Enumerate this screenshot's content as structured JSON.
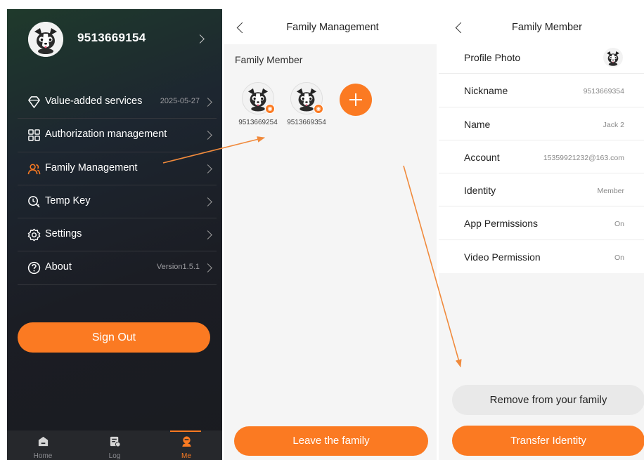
{
  "colors": {
    "accent": "#fb7a22",
    "drawer_bg": "#1b1d24",
    "panel_bg": "#f5f5f5"
  },
  "me_panel": {
    "username": "9513669154",
    "menu": [
      {
        "label": "Value-added services",
        "value": "2025-05-27",
        "icon": "diamond-icon"
      },
      {
        "label": "Authorization management",
        "value": "",
        "icon": "grid-icon"
      },
      {
        "label": "Family Management",
        "value": "",
        "icon": "family-icon"
      },
      {
        "label": "Temp Key",
        "value": "",
        "icon": "temp-key-icon"
      },
      {
        "label": "Settings",
        "value": "",
        "icon": "gear-icon"
      },
      {
        "label": "About",
        "value": "Version1.5.1",
        "icon": "question-icon"
      }
    ],
    "sign_out": "Sign Out",
    "tabs": [
      {
        "label": "Home",
        "icon": "home-icon",
        "active": false
      },
      {
        "label": "Log",
        "icon": "log-icon",
        "active": false
      },
      {
        "label": "Me",
        "icon": "me-icon",
        "active": true
      }
    ]
  },
  "family_management": {
    "title": "Family Management",
    "section_title": "Family Member",
    "members": [
      {
        "name": "9513669254"
      },
      {
        "name": "9513669354"
      }
    ],
    "leave_button": "Leave the family"
  },
  "family_member": {
    "title": "Family Member",
    "rows": [
      {
        "label": "Profile Photo",
        "value": ""
      },
      {
        "label": "Nickname",
        "value": "9513669354"
      },
      {
        "label": "Name",
        "value": "Jack 2"
      },
      {
        "label": "Account",
        "value": "15359921232@163.com"
      },
      {
        "label": "Identity",
        "value": "Member"
      },
      {
        "label": "App Permissions",
        "value": "On"
      },
      {
        "label": "Video Permission",
        "value": "On"
      }
    ],
    "remove_button": "Remove from your family",
    "transfer_button": "Transfer Identity"
  }
}
